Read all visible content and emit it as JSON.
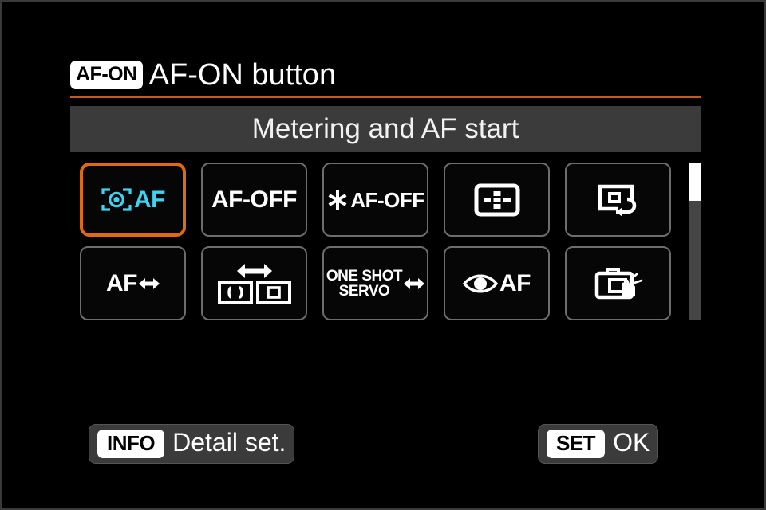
{
  "screen": {
    "background": "#000000",
    "accent_orange": "#e06a11",
    "rule_color": "#c75a1d",
    "cyan": "#3fd2f2"
  },
  "header": {
    "key_badge": "AF-ON",
    "title": "AF-ON button"
  },
  "subtitle": {
    "text": "Metering and AF start"
  },
  "grid": {
    "selected_index": 0,
    "tiles": [
      {
        "index": 0,
        "icon": "metering-af-icon",
        "label": "AF",
        "name": "metering-and-af-start",
        "selected": true
      },
      {
        "index": 1,
        "icon": "af-off-text-icon",
        "label": "AF-OFF",
        "name": "af-off",
        "selected": false
      },
      {
        "index": 2,
        "icon": "ae-lock-asterisk-icon",
        "label": "AF-OFF",
        "name": "ae-lock-af-off",
        "selected": false
      },
      {
        "index": 3,
        "icon": "af-point-selection-icon",
        "label": "",
        "name": "af-point-selection",
        "selected": false
      },
      {
        "index": 4,
        "icon": "registered-af-point-icon",
        "label": "",
        "name": "switch-to-registered-af-point",
        "selected": false
      },
      {
        "index": 5,
        "icon": "af-arrow-icon",
        "label": "AF",
        "name": "direct-af-method-selection",
        "selected": false
      },
      {
        "index": 6,
        "icon": "af-area-switch-icon",
        "label": "",
        "name": "af-area-switching",
        "selected": false
      },
      {
        "index": 7,
        "icon": "one-shot-servo-arrow-icon",
        "label_line1": "ONE SHOT",
        "label_line2": "SERVO",
        "name": "one-shot-servo-switching",
        "selected": false
      },
      {
        "index": 8,
        "icon": "eye-af-icon",
        "label": "AF",
        "name": "eye-detection-af",
        "selected": false
      },
      {
        "index": 9,
        "icon": "camera-hand-icon",
        "label": "",
        "name": "touch-and-drag-af",
        "selected": false
      }
    ]
  },
  "scrollbar": {
    "orientation": "vertical",
    "thumb_position": "top"
  },
  "footer": {
    "info_badge": "INFO",
    "info_label": "Detail set.",
    "set_badge": "SET",
    "set_label": "OK"
  }
}
